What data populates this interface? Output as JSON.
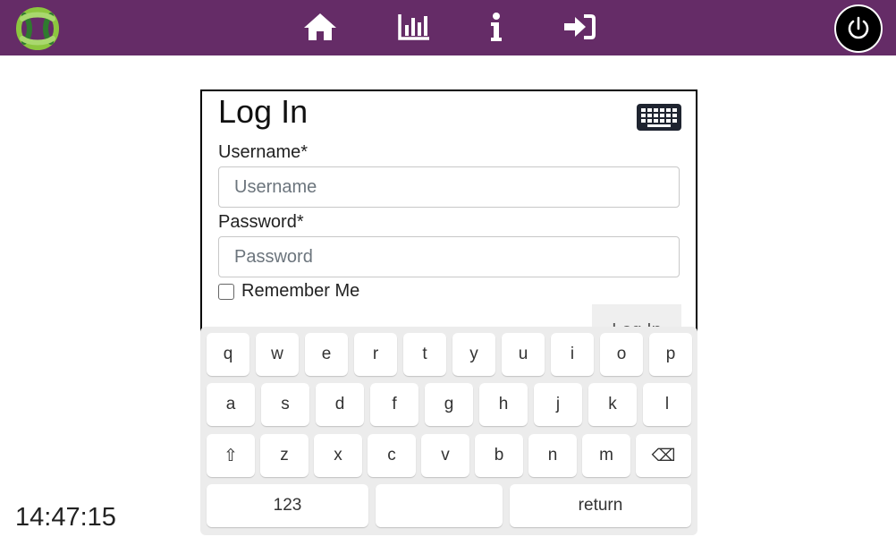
{
  "topbar": {
    "background": "#652c67",
    "nav": [
      {
        "icon": "home-icon"
      },
      {
        "icon": "chart-icon"
      },
      {
        "icon": "info-icon"
      },
      {
        "icon": "sign-in-icon"
      }
    ],
    "power_icon": "power-icon"
  },
  "login": {
    "title": "Log In",
    "keyboard_icon": "keyboard-icon",
    "username_label": "Username*",
    "username_placeholder": "Username",
    "username_value": "",
    "password_label": "Password*",
    "password_placeholder": "Password",
    "password_value": "",
    "remember_label": "Remember Me",
    "remember_checked": false,
    "submit_label": "Log In"
  },
  "keyboard": {
    "row1": [
      "q",
      "w",
      "e",
      "r",
      "t",
      "y",
      "u",
      "i",
      "o",
      "p"
    ],
    "row2": [
      "a",
      "s",
      "d",
      "f",
      "g",
      "h",
      "j",
      "k",
      "l"
    ],
    "row3": [
      "⇧",
      "z",
      "x",
      "c",
      "v",
      "b",
      "n",
      "m",
      "⌫"
    ],
    "numbers_label": "123",
    "space_label": "",
    "return_label": "return"
  },
  "clock": "14:47:15"
}
